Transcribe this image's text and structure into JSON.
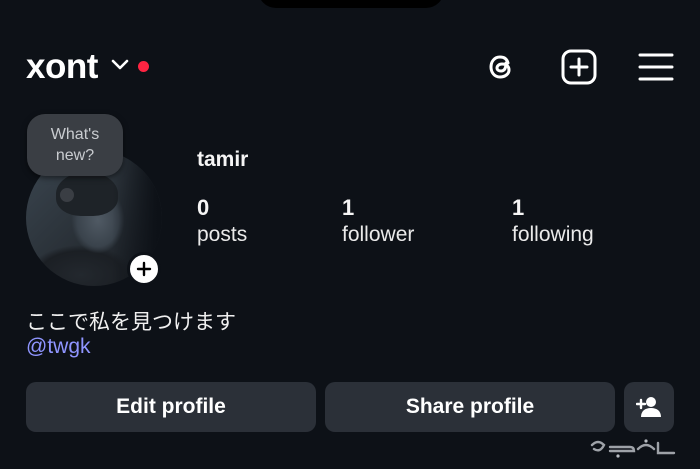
{
  "header": {
    "username": "xont",
    "icons": [
      "chevron-down-icon",
      "notification-dot",
      "threads-icon",
      "add-post-icon",
      "menu-icon"
    ]
  },
  "avatar": {
    "note_bubble": "What's new?"
  },
  "profile": {
    "display_name": "tamir",
    "stats": [
      {
        "count": "0",
        "label": "posts"
      },
      {
        "count": "1",
        "label": "follower"
      },
      {
        "count": "1",
        "label": "following"
      }
    ],
    "bio": "ここで私を見つけます",
    "handle_link": "@twgk"
  },
  "actions": {
    "edit_label": "Edit profile",
    "share_label": "Share profile"
  },
  "colors": {
    "background": "#0d1117",
    "button": "#2b3038",
    "link": "#8f95ff",
    "dot": "#ff2442"
  }
}
